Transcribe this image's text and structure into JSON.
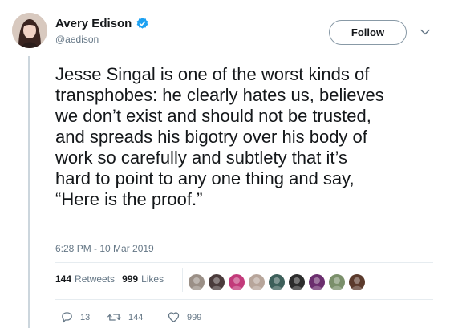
{
  "author": {
    "display_name": "Avery Edison",
    "handle": "@aedison",
    "verified": true,
    "icon": "verified-badge-icon"
  },
  "follow_button": {
    "label": "Follow"
  },
  "menu": {
    "icon": "chevron-down-icon"
  },
  "tweet": {
    "text": "Jesse Singal is one of the worst kinds of\ntransphobes: he clearly hates us, believes\nwe don’t exist and should not be trusted,\nand spreads his bigotry over his body of\nwork so carefully and subtlety that it’s\nhard to point to any one thing and say,\n“Here is the proof.”",
    "timestamp": "6:28 PM - 10 Mar 2019"
  },
  "stats": {
    "retweets_count": "144",
    "retweets_label": "Retweets",
    "likes_count": "999",
    "likes_label": "Likes",
    "liker_avatar_colors": [
      "#9a8f86",
      "#4a3b3b",
      "#c23a7a",
      "#b7a59a",
      "#3d5f5a",
      "#2c2c2c",
      "#6b2e6e",
      "#7a8f6a",
      "#5b3a2c"
    ]
  },
  "actions": {
    "reply_count": "13",
    "retweet_count": "144",
    "like_count": "999",
    "icons": [
      "reply-icon",
      "retweet-icon",
      "heart-icon"
    ]
  },
  "colors": {
    "text": "#14171a",
    "secondary": "#657786",
    "verified_blue": "#1da1f2",
    "divider": "#e6ecf0"
  }
}
